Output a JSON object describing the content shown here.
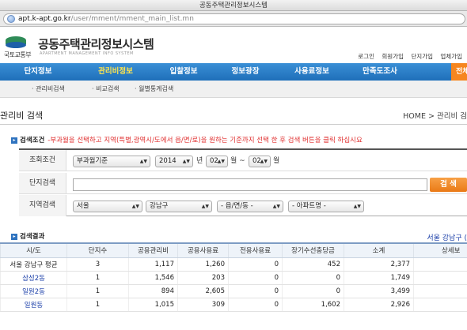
{
  "window": {
    "title": "공동주택관리정보시스템"
  },
  "address_bar": {
    "host": "apt.k-apt.go.kr",
    "path": "/user/mment/mment_main_list.mn"
  },
  "header": {
    "logo_text": "국토교통부",
    "site_title": "공동주택관리정보시스템",
    "site_subtitle": "APARTMENT MANAGEMENT INFO SYSTEM",
    "util_links": [
      "로그인",
      "회원가입",
      "단지가입",
      "업체가입"
    ]
  },
  "gnb": {
    "items": [
      "단지정보",
      "관리비정보",
      "입찰정보",
      "정보광장",
      "사용료정보",
      "만족도조사"
    ],
    "active_index": 1,
    "extra_label": "전체"
  },
  "subnav": {
    "items": [
      "관리비검색",
      "비교검색",
      "월별통계검색"
    ]
  },
  "page": {
    "title": "관리비 검색",
    "breadcrumb_home": "HOME",
    "breadcrumb_sep": ">",
    "breadcrumb_current": "관리비 검"
  },
  "search": {
    "condition_label": "검색조건",
    "condition_note": "-부과월을 선택하고 지역(특별,광역시/도에서 읍/면/로)을 원하는 기준까지 선택 한 후 검색 버튼을 클릭 하십시요",
    "row1_label": "조회조건",
    "period_type": "부과월기준",
    "year": "2014",
    "year_unit": "년",
    "month_from": "02",
    "month_unit_from": "월 ~",
    "month_to": "02",
    "month_unit_to": "월",
    "row2_label": "단지검색",
    "complex_input_value": "",
    "search_button": "검 색",
    "row3_label": "지역검색",
    "region_sido": "서울",
    "region_gu": "강남구",
    "region_dong": "- 읍/면/동 -",
    "region_apt": "- 아파트명 -"
  },
  "results": {
    "label": "검색결과",
    "region_label": "서울 강남구 (",
    "columns": [
      "시/도",
      "단지수",
      "공용관리비",
      "공용사용료",
      "전용사용료",
      "장기수선충당금",
      "소계",
      "상세보"
    ],
    "rows": [
      [
        "서울 강남구 평균",
        "3",
        "1,117",
        "1,260",
        "0",
        "452",
        "2,377",
        ""
      ],
      [
        "삼성2동",
        "1",
        "1,546",
        "203",
        "0",
        "0",
        "1,749",
        ""
      ],
      [
        "일원2동",
        "1",
        "894",
        "2,605",
        "0",
        "0",
        "3,499",
        ""
      ],
      [
        "일원동",
        "1",
        "1,015",
        "309",
        "0",
        "1,602",
        "2,926",
        ""
      ]
    ]
  },
  "colors": {
    "nav_blue": "#1f6fb9",
    "active_yellow": "#ffe54d",
    "accent_orange": "#ea7a16",
    "note_red": "#e03030",
    "link_blue": "#1a3ea8"
  }
}
